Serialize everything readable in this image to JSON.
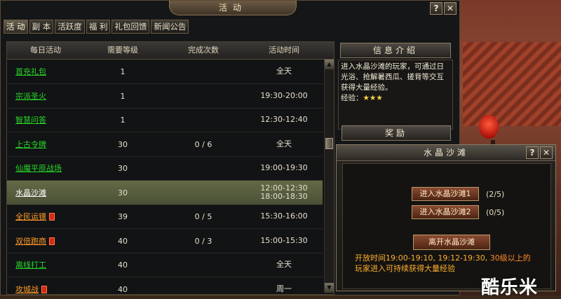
{
  "window": {
    "title": "活动",
    "help_label": "?",
    "close_label": "✕"
  },
  "tabs": [
    {
      "label": "活 动",
      "active": true
    },
    {
      "label": "副 本"
    },
    {
      "label": "活跃度"
    },
    {
      "label": "福 利"
    },
    {
      "label": "礼包回馈"
    },
    {
      "label": "新闻公告"
    }
  ],
  "table": {
    "headers": [
      "每日活动",
      "需要等级",
      "完成次数",
      "活动时间"
    ],
    "rows": [
      {
        "name": "首充礼包",
        "level": "1",
        "count": "",
        "time1": "全天",
        "time2": "",
        "color": "green"
      },
      {
        "name": "宗派圣火",
        "level": "1",
        "count": "",
        "time1": "19:30-20:00",
        "time2": "",
        "color": "green"
      },
      {
        "name": "智慧问答",
        "level": "1",
        "count": "",
        "time1": "12:30-12:40",
        "time2": "",
        "color": "green"
      },
      {
        "name": "上古令牌",
        "level": "30",
        "count": "0 / 6",
        "time1": "全天",
        "time2": "",
        "color": "green"
      },
      {
        "name": "仙魔平原战场",
        "level": "30",
        "count": "",
        "time1": "19:00-19:30",
        "time2": "",
        "color": "green"
      },
      {
        "name": "水晶沙滩",
        "level": "30",
        "count": "",
        "time1": "12:00-12:30",
        "time2": "18:00-18:30",
        "color": "white",
        "selected": true
      },
      {
        "name": "全民运镖",
        "level": "39",
        "count": "0 / 5",
        "time1": "15:30-16:00",
        "time2": "",
        "color": "orange",
        "bag": true
      },
      {
        "name": "双倍跑商",
        "level": "40",
        "count": "0 / 3",
        "time1": "15:00-15:30",
        "time2": "",
        "color": "orange",
        "bag": true
      },
      {
        "name": "离线打工",
        "level": "40",
        "count": "",
        "time1": "全天",
        "time2": "",
        "color": "green"
      },
      {
        "name": "攻城战",
        "level": "40",
        "count": "",
        "time1": "周一",
        "time2": "",
        "color": "orange",
        "bag": true
      }
    ]
  },
  "info_panel": {
    "title": "信息介绍",
    "text": "进入水晶沙滩的玩家，可通过日光浴、抢解暑西瓜、搓背等交互获得大量经验。",
    "exp_label": "经验：",
    "stars": "★★★"
  },
  "reward_panel": {
    "title": "奖励"
  },
  "popup": {
    "title": "水晶沙滩",
    "help_label": "?",
    "close_label": "✕",
    "enter1_label": "进入水晶沙滩1",
    "enter1_count": "(2/5)",
    "enter2_label": "进入水晶沙滩2",
    "enter2_count": "(0/5)",
    "leave_label": "离开水晶沙滩",
    "open_time_prefix": "开放时间19:00-19:10, 19:12-19:30, ",
    "open_time_hl": "30级以上的",
    "open_time_suffix": "玩家进入可持续获得大量经验"
  },
  "watermark": "酷乐米"
}
